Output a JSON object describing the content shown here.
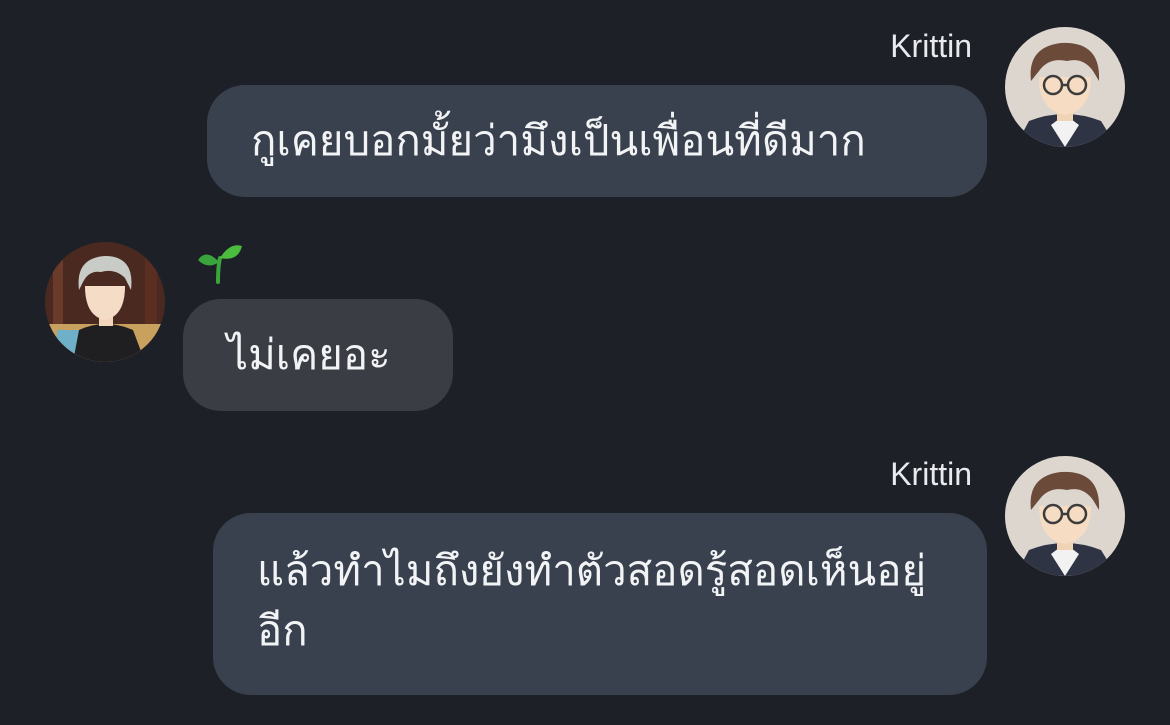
{
  "messages": [
    {
      "direction": "outgoing",
      "sender": "Krittin",
      "avatar": "glasses-boy-avatar",
      "text": "กูเคยบอกมั้ยว่ามึงเป็นเพื่อนที่ดีมาก"
    },
    {
      "direction": "incoming",
      "sender_icon": "seedling-icon",
      "sender_glyph": "🌱",
      "avatar": "silver-hair-boy-avatar",
      "text": "ไม่เคยอะ"
    },
    {
      "direction": "outgoing",
      "sender": "Krittin",
      "avatar": "glasses-boy-avatar",
      "text": "แล้วทำไมถึงยังทำตัวสอดรู้สอดเห็นอยู่อีก"
    }
  ],
  "colors": {
    "background": "#1e2028",
    "outgoing_bubble": "#39414f",
    "incoming_bubble": "#3b3d44",
    "text": "#f2f3f5",
    "name": "#e9eaee",
    "seedling": "#3aa53c"
  }
}
